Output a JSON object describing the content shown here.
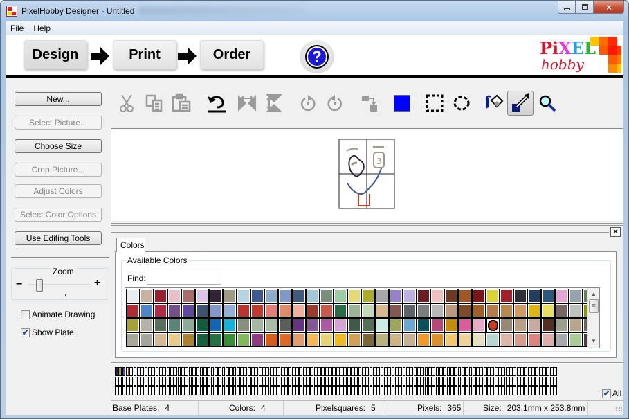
{
  "window": {
    "title": "PixelHobby Designer - Untitled",
    "controls": {
      "minimize": "minimize",
      "maximize": "maximize",
      "close": "×"
    }
  },
  "menu": [
    "File",
    "Help"
  ],
  "header": {
    "steps": [
      "Design",
      "Print",
      "Order"
    ],
    "help_label": "?",
    "logo": {
      "pixel": [
        "P",
        "i",
        "X",
        "E",
        "L"
      ],
      "pixel_colors": [
        "#d8162a",
        "#d8162a",
        "#e23bd0",
        "#2b9ee6",
        "#25b832"
      ],
      "hobby": "hobby"
    }
  },
  "sidebar": {
    "buttons": [
      {
        "label": "New...",
        "enabled": true
      },
      {
        "label": "Select Picture...",
        "enabled": false
      },
      {
        "label": "Choose Size",
        "enabled": true
      },
      {
        "label": "Crop Picture...",
        "enabled": false
      },
      {
        "label": "Adjust Colors",
        "enabled": false
      },
      {
        "label": "Select Color Options",
        "enabled": false
      },
      {
        "label": "Use Editing Tools",
        "enabled": true
      }
    ],
    "zoom": {
      "label": "Zoom",
      "minus": "−",
      "plus": "+",
      "level": 0.12
    },
    "animate_drawing": {
      "label": "Animate Drawing",
      "checked": false
    },
    "show_plate": {
      "label": "Show Plate",
      "checked": true
    }
  },
  "toolbar": {
    "tools": [
      {
        "name": "cut-icon",
        "enabled": false
      },
      {
        "name": "copy-icon",
        "enabled": false
      },
      {
        "name": "paste-icon",
        "enabled": false
      },
      {
        "name": "undo-icon",
        "enabled": true
      },
      {
        "name": "flip-horizontal-icon",
        "enabled": false
      },
      {
        "name": "flip-vertical-icon",
        "enabled": false
      },
      {
        "name": "rotate-right-icon",
        "enabled": false
      },
      {
        "name": "rotate-left-icon",
        "enabled": false
      },
      {
        "name": "move-icon",
        "enabled": false
      },
      {
        "name": "current-color-swatch",
        "enabled": true
      },
      {
        "name": "rect-select-icon",
        "enabled": true
      },
      {
        "name": "lasso-select-icon",
        "enabled": true
      },
      {
        "name": "fill-bucket-icon",
        "enabled": true
      },
      {
        "name": "pencil-icon",
        "enabled": true,
        "active": true
      },
      {
        "name": "magnifier-icon",
        "enabled": true
      }
    ],
    "current_color": "#0000ff"
  },
  "panel": {
    "close_label": "×",
    "tab": "Colors",
    "group_label": "Available Colors",
    "find_label": "Find:",
    "find_value": "",
    "selected_index": [
      2,
      26
    ],
    "palette": [
      [
        "#e8ecef",
        "#c8b3a0",
        "#962133",
        "#e7c1c8",
        "#a96d6a",
        "#dcc4e4",
        "#322334",
        "#9f9985",
        "#b6d3e0",
        "#41578f",
        "#8eaac9",
        "#7f98c4",
        "#3f5a7a",
        "#a4c6d9",
        "#7a8e7c",
        "#9dcca4",
        "#e3d977",
        "#abab2c",
        "#a6a7a8",
        "#9682c4",
        "#bdb0dc",
        "#6a1e24",
        "#efc2c1",
        "#6b3a22",
        "#a25624",
        "#7c1519",
        "#dcd235",
        "#a0212a",
        "#2f3035",
        "#223d5d",
        "#2c5880",
        "#e3a7d3",
        "#96a2ad",
        "#677f59"
      ],
      [
        "#b02c33",
        "#5086c9",
        "#ae2c47",
        "#745089",
        "#5d479c",
        "#3a526e",
        "#8297c9",
        "#94b0d7",
        "#b8352d",
        "#c0392f",
        "#e17e78",
        "#dd8c6c",
        "#f0b1a0",
        "#9c3a2c",
        "#c55a4d",
        "#2b6b46",
        "#9cb695",
        "#c6d6b9",
        "#dab88d",
        "#815952",
        "#5d6367",
        "#7b7d7e",
        "#b7b7b7",
        "#b9987b",
        "#7d4b2a",
        "#a15e26",
        "#b67b4b",
        "#b78955",
        "#d09a63",
        "#dfb514",
        "#e9df62",
        "#766462",
        "#bdc1c0",
        "#8b9410"
      ],
      [
        "#a4a337",
        "#b6b1a9",
        "#5a705f",
        "#5a8478",
        "#89ab98",
        "#125c3e",
        "#1466b4",
        "#19b0d9",
        "#88917f",
        "#a6b8a4",
        "#a9bda6",
        "#5a5f5c",
        "#633480",
        "#845893",
        "#ab5aa1",
        "#d3a3d3",
        "#3f5a49",
        "#567058",
        "#cbece2",
        "#9ea55e",
        "#6ba7d0",
        "#0a515a",
        "#b64878",
        "#c28e0b",
        "#d95e9b",
        "#e8abc7",
        "#cc3e1e",
        "#948a75",
        "#b8a086",
        "#c7aa9f",
        "#552f23",
        "#9d9f8e",
        "#b9a78c",
        "#6b6458"
      ],
      [
        "#a9a99b",
        "#a5a49e",
        "#d6b994",
        "#e8cb88",
        "#ab8330",
        "#16603c",
        "#277243",
        "#3a8b36",
        "#82b95d",
        "#8e3b7f",
        "#d95a19",
        "#de6a28",
        "#e09e6c",
        "#f3b857",
        "#e6d277",
        "#efb825",
        "#d4a154",
        "#7a6735",
        "#b8b27c",
        "#ceb387",
        "#c6b190",
        "#ed9a2a",
        "#dd8f2a",
        "#f2c873",
        "#eed397",
        "#e6e0c3",
        "#b6d6d2",
        "#ddb6a8",
        "#d49c8c",
        "#dd847f",
        "#ddadac",
        "#a6a9ab",
        "#a8cc93",
        "#4b3c3e"
      ]
    ]
  },
  "plates": {
    "rows": 3,
    "per_row": 120,
    "used_colors": [
      "#322334",
      "#9f9985",
      "#41578f",
      "#cc3e1e"
    ],
    "all_label": "All",
    "all_checked": true
  },
  "status": {
    "base_plates_label": "Base Plates:",
    "base_plates": "4",
    "colors_label": "Colors:",
    "colors": "4",
    "pixelsquares_label": "Pixelsquares:",
    "pixelsquares": "5",
    "pixels_label": "Pixels:",
    "pixels": "365",
    "size_label": "Size:",
    "size": "203.1mm x 253.8mm"
  }
}
